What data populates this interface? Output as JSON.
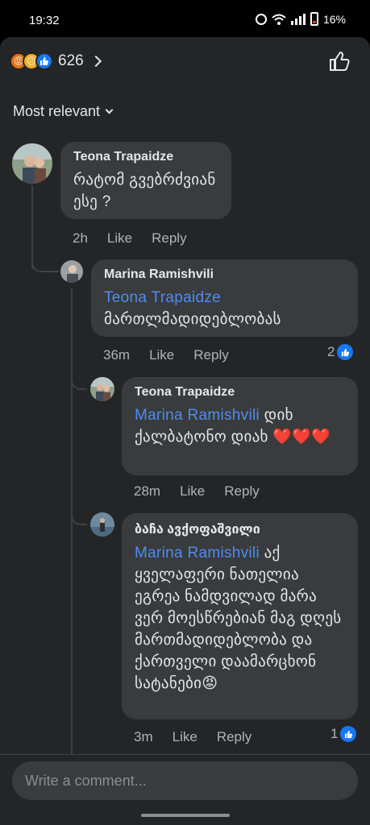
{
  "status": {
    "time": "19:32",
    "battery": "16%"
  },
  "header": {
    "reaction_count": "626",
    "sort_label": "Most relevant"
  },
  "comments": [
    {
      "author": "Teona Trapaidze",
      "text": "რატომ გვებრძვიან ესე ?",
      "time": "2h",
      "like": "Like",
      "reply": "Reply"
    },
    {
      "author": "Marina Ramishvili",
      "mention": "Teona Trapaidze",
      "text": "მართლმადიდებლობას",
      "time": "36m",
      "like": "Like",
      "reply": "Reply",
      "likes": "2"
    },
    {
      "author": "Teona Trapaidze",
      "mention": "Marina Ramishvili",
      "text": " დიხ ქალბატონო დიახ ❤️❤️❤️",
      "time": "28m",
      "like": "Like",
      "reply": "Reply"
    },
    {
      "author": "ბაჩა ავქოფაშვილი",
      "mention": "Marina Ramishvili",
      "text": " აქ ყველაფერი ნათელია ეგრეა ნამდვილად მარა ვერ მოესწრებიან მაგ დღეს მართმადიდებლობა და ქართველი დაამარცხონ სატანები😡",
      "time": "3m",
      "like": "Like",
      "reply": "Reply",
      "likes": "1"
    }
  ],
  "composer": {
    "placeholder": "Write a comment..."
  },
  "colors": {
    "background": "#242526",
    "bubble": "#3a3b3c",
    "mention": "#4e8cf4",
    "like_blue": "#1877f2"
  }
}
